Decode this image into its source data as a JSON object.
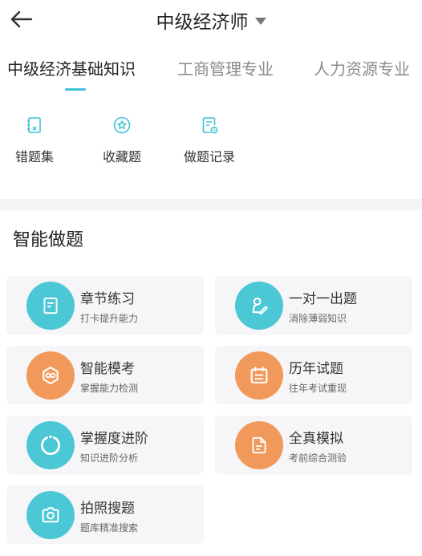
{
  "header": {
    "title": "中级经济师",
    "back_icon": "arrow-left-icon",
    "dropdown_icon": "caret-down-icon"
  },
  "tabs": [
    {
      "label": "中级经济基础知识",
      "active": true
    },
    {
      "label": "工商管理专业",
      "active": false
    },
    {
      "label": "人力资源专业",
      "active": false
    }
  ],
  "quick_actions": [
    {
      "label": "错题集",
      "icon": "wrong-notebook-icon"
    },
    {
      "label": "收藏题",
      "icon": "star-circle-icon"
    },
    {
      "label": "做题记录",
      "icon": "record-doc-icon"
    }
  ],
  "section": {
    "title": "智能做题"
  },
  "cards": [
    {
      "title": "章节练习",
      "subtitle": "打卡提升能力",
      "icon": "document-icon",
      "color": "teal"
    },
    {
      "title": "一对一出题",
      "subtitle": "消除薄弱知识",
      "icon": "person-pen-icon",
      "color": "teal"
    },
    {
      "title": "智能模考",
      "subtitle": "掌握能力检测",
      "icon": "smart-brain-icon",
      "color": "orange"
    },
    {
      "title": "历年试题",
      "subtitle": "往年考试重现",
      "icon": "calendar-icon",
      "color": "orange"
    },
    {
      "title": "掌握度进阶",
      "subtitle": "知识进阶分析",
      "icon": "progress-ring-icon",
      "color": "teal"
    },
    {
      "title": "全真模拟",
      "subtitle": "考前综合测验",
      "icon": "file-icon",
      "color": "orange"
    },
    {
      "title": "拍照搜题",
      "subtitle": "题库精准搜索",
      "icon": "camera-icon",
      "color": "teal"
    }
  ],
  "colors": {
    "accent_teal": "#4cc7d6",
    "accent_orange": "#f1995b",
    "tab_underline": "#3cc2d6",
    "card_bg": "#f6f6f8"
  }
}
